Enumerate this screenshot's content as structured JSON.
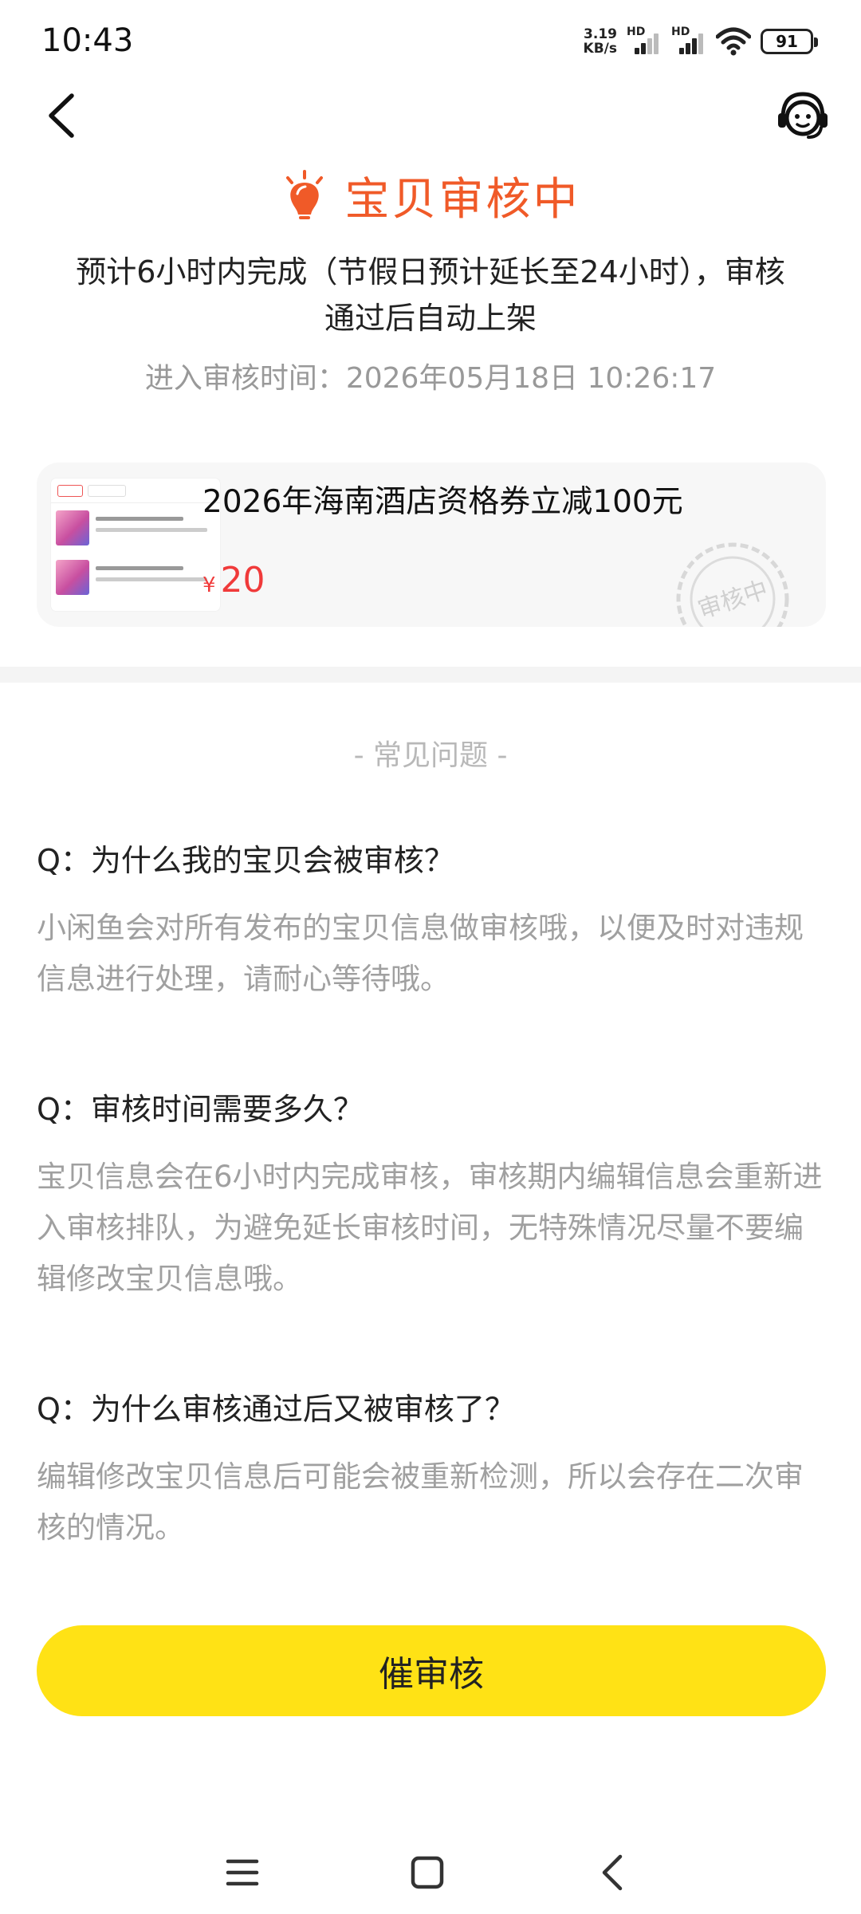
{
  "status_bar": {
    "time": "10:43",
    "net_speed_value": "3.19",
    "net_speed_unit": "KB/s",
    "signal_1_label": "HD",
    "signal_2_label": "HD",
    "battery": "91"
  },
  "nav": {
    "back_icon": "chevron-left-icon",
    "service_icon": "customer-service-icon"
  },
  "review_status": {
    "icon": "lightbulb-icon",
    "title": "宝贝审核中",
    "description": "预计6小时内完成（节假日预计延长至24小时），审核通过后自动上架",
    "entered_time": "进入审核时间：2026年05月18日 10:26:17"
  },
  "product": {
    "title": "2026年海南酒店资格券立减100元",
    "currency": "¥",
    "price": "20",
    "stamp_text": "审核中"
  },
  "faq": {
    "header": "- 常见问题 -",
    "items": [
      {
        "q": "Q：为什么我的宝贝会被审核？",
        "a": "小闲鱼会对所有发布的宝贝信息做审核哦，以便及时对违规信息进行处理，请耐心等待哦。"
      },
      {
        "q": "Q：审核时间需要多久？",
        "a": "宝贝信息会在6小时内完成审核，审核期内编辑信息会重新进入审核排队，为避免延长审核时间，无特殊情况尽量不要编辑修改宝贝信息哦。"
      },
      {
        "q": "Q：为什么审核通过后又被审核了？",
        "a": "编辑修改宝贝信息后可能会被重新检测，所以会存在二次审核的情况。"
      }
    ]
  },
  "action": {
    "urge_label": "催审核"
  },
  "colors": {
    "accent": "#f05a28",
    "price": "#f03a3a",
    "button": "#ffe215"
  }
}
